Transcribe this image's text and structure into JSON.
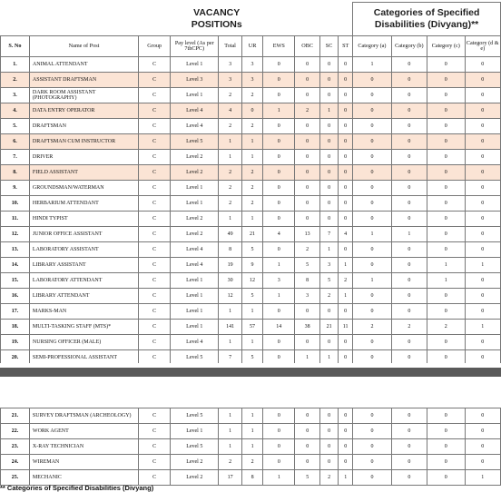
{
  "header": {
    "vacancy_title": "VACANCY POSITIONs",
    "categories_title": "Categories of Specified Disabilities (Divyang)**",
    "columns": [
      "S. No",
      "Name of Post",
      "Group",
      "Pay level (As per 7thCPC)",
      "Total",
      "UR",
      "EWS",
      "OBC",
      "SC",
      "ST",
      "Category (a)",
      "Category (b)",
      "Category (c)",
      "Category (d & e)"
    ]
  },
  "rows": [
    {
      "sno": "1.",
      "post": "ANIMAL ATTENDANT",
      "group": "C",
      "pay": "Level 1",
      "total": "3",
      "ur": "3",
      "ews": "0",
      "obc": "0",
      "sc": "0",
      "st": "0",
      "a": "1",
      "b": "0",
      "c": "0",
      "de": "0",
      "highlight": false
    },
    {
      "sno": "2.",
      "post": "ASSISTANT DRAFTSMAN",
      "group": "C",
      "pay": "Level 3",
      "total": "3",
      "ur": "3",
      "ews": "0",
      "obc": "0",
      "sc": "0",
      "st": "0",
      "a": "0",
      "b": "0",
      "c": "0",
      "de": "0",
      "highlight": true
    },
    {
      "sno": "3.",
      "post": "DARK ROOM ASSISTANT (PHOTOGRAPHY)",
      "group": "C",
      "pay": "Level 1",
      "total": "2",
      "ur": "2",
      "ews": "0",
      "obc": "0",
      "sc": "0",
      "st": "0",
      "a": "0",
      "b": "0",
      "c": "0",
      "de": "0",
      "highlight": false
    },
    {
      "sno": "4.",
      "post": "DATA ENTRY OPERATOR",
      "group": "C",
      "pay": "Level 4",
      "total": "4",
      "ur": "0",
      "ews": "1",
      "obc": "2",
      "sc": "1",
      "st": "0",
      "a": "0",
      "b": "0",
      "c": "0",
      "de": "0",
      "highlight": true
    },
    {
      "sno": "5.",
      "post": "DRAFTSMAN",
      "group": "C",
      "pay": "Level 4",
      "total": "2",
      "ur": "2",
      "ews": "0",
      "obc": "0",
      "sc": "0",
      "st": "0",
      "a": "0",
      "b": "0",
      "c": "0",
      "de": "0",
      "highlight": false
    },
    {
      "sno": "6.",
      "post": "DRAFTSMAN CUM INSTRUCTOR",
      "group": "C",
      "pay": "Level 5",
      "total": "1",
      "ur": "1",
      "ews": "0",
      "obc": "0",
      "sc": "0",
      "st": "0",
      "a": "0",
      "b": "0",
      "c": "0",
      "de": "0",
      "highlight": true
    },
    {
      "sno": "7.",
      "post": "DRIVER",
      "group": "C",
      "pay": "Level 2",
      "total": "1",
      "ur": "1",
      "ews": "0",
      "obc": "0",
      "sc": "0",
      "st": "0",
      "a": "0",
      "b": "0",
      "c": "0",
      "de": "0",
      "highlight": false
    },
    {
      "sno": "8.",
      "post": "FIELD ASSISTANT",
      "group": "C",
      "pay": "Level 2",
      "total": "2",
      "ur": "2",
      "ews": "0",
      "obc": "0",
      "sc": "0",
      "st": "0",
      "a": "0",
      "b": "0",
      "c": "0",
      "de": "0",
      "highlight": true
    },
    {
      "sno": "9.",
      "post": "GROUNDSMAN/WATERMAN",
      "group": "C",
      "pay": "Level 1",
      "total": "2",
      "ur": "2",
      "ews": "0",
      "obc": "0",
      "sc": "0",
      "st": "0",
      "a": "0",
      "b": "0",
      "c": "0",
      "de": "0",
      "highlight": false
    },
    {
      "sno": "10.",
      "post": "HERBARIUM ATTENDANT",
      "group": "C",
      "pay": "Level 1",
      "total": "2",
      "ur": "2",
      "ews": "0",
      "obc": "0",
      "sc": "0",
      "st": "0",
      "a": "0",
      "b": "0",
      "c": "0",
      "de": "0",
      "highlight": false
    },
    {
      "sno": "11.",
      "post": "HINDI TYPIST",
      "group": "C",
      "pay": "Level 2",
      "total": "1",
      "ur": "1",
      "ews": "0",
      "obc": "0",
      "sc": "0",
      "st": "0",
      "a": "0",
      "b": "0",
      "c": "0",
      "de": "0",
      "highlight": false
    },
    {
      "sno": "12.",
      "post": "JUNIOR OFFICE ASSISTANT",
      "group": "C",
      "pay": "Level 2",
      "total": "49",
      "ur": "21",
      "ews": "4",
      "obc": "13",
      "sc": "7",
      "st": "4",
      "a": "1",
      "b": "1",
      "c": "0",
      "de": "0",
      "highlight": false
    },
    {
      "sno": "13.",
      "post": "LABORATORY ASSISTANT",
      "group": "C",
      "pay": "Level 4",
      "total": "8",
      "ur": "5",
      "ews": "0",
      "obc": "2",
      "sc": "1",
      "st": "0",
      "a": "0",
      "b": "0",
      "c": "0",
      "de": "0",
      "highlight": false
    },
    {
      "sno": "14.",
      "post": "LIBRARY ASSISTANT",
      "group": "C",
      "pay": "Level 4",
      "total": "19",
      "ur": "9",
      "ews": "1",
      "obc": "5",
      "sc": "3",
      "st": "1",
      "a": "0",
      "b": "0",
      "c": "1",
      "de": "1",
      "highlight": false
    },
    {
      "sno": "15.",
      "post": "LABORATORY ATTENDANT",
      "group": "C",
      "pay": "Level 1",
      "total": "30",
      "ur": "12",
      "ews": "3",
      "obc": "8",
      "sc": "5",
      "st": "2",
      "a": "1",
      "b": "0",
      "c": "1",
      "de": "0",
      "highlight": false
    },
    {
      "sno": "16.",
      "post": "LIBRARY ATTENDANT",
      "group": "C",
      "pay": "Level 1",
      "total": "12",
      "ur": "5",
      "ews": "1",
      "obc": "3",
      "sc": "2",
      "st": "1",
      "a": "0",
      "b": "0",
      "c": "0",
      "de": "0",
      "highlight": false
    },
    {
      "sno": "17.",
      "post": "MARKS-MAN",
      "group": "C",
      "pay": "Level 1",
      "total": "1",
      "ur": "1",
      "ews": "0",
      "obc": "0",
      "sc": "0",
      "st": "0",
      "a": "0",
      "b": "0",
      "c": "0",
      "de": "0",
      "highlight": false
    },
    {
      "sno": "18.",
      "post": "MULTI-TASKING STAFF (MTS)*",
      "group": "C",
      "pay": "Level 1",
      "total": "141",
      "ur": "57",
      "ews": "14",
      "obc": "38",
      "sc": "21",
      "st": "11",
      "a": "2",
      "b": "2",
      "c": "2",
      "de": "1",
      "highlight": false
    },
    {
      "sno": "19.",
      "post": "NURSING OFFICER (MALE)",
      "group": "C",
      "pay": "Level 4",
      "total": "1",
      "ur": "1",
      "ews": "0",
      "obc": "0",
      "sc": "0",
      "st": "0",
      "a": "0",
      "b": "0",
      "c": "0",
      "de": "0",
      "highlight": false
    },
    {
      "sno": "20.",
      "post": "SEMI-PROFESSIONAL ASSISTANT",
      "group": "C",
      "pay": "Level 5",
      "total": "7",
      "ur": "5",
      "ews": "0",
      "obc": "1",
      "sc": "1",
      "st": "0",
      "a": "0",
      "b": "0",
      "c": "0",
      "de": "0",
      "highlight": false
    }
  ],
  "rows2": [
    {
      "sno": "21.",
      "post": "SURVEY DRAFTSMAN (ARCHEOLOGY)",
      "group": "C",
      "pay": "Level 5",
      "total": "1",
      "ur": "1",
      "ews": "0",
      "obc": "0",
      "sc": "0",
      "st": "0",
      "a": "0",
      "b": "0",
      "c": "0",
      "de": "0",
      "highlight": false
    },
    {
      "sno": "22.",
      "post": "WORK AGENT",
      "group": "C",
      "pay": "Level 1",
      "total": "1",
      "ur": "1",
      "ews": "0",
      "obc": "0",
      "sc": "0",
      "st": "0",
      "a": "0",
      "b": "0",
      "c": "0",
      "de": "0",
      "highlight": false
    },
    {
      "sno": "23.",
      "post": "X-RAY TECHNICIAN",
      "group": "C",
      "pay": "Level 5",
      "total": "1",
      "ur": "1",
      "ews": "0",
      "obc": "0",
      "sc": "0",
      "st": "0",
      "a": "0",
      "b": "0",
      "c": "0",
      "de": "0",
      "highlight": false
    },
    {
      "sno": "24.",
      "post": "WIREMAN",
      "group": "C",
      "pay": "Level 2",
      "total": "2",
      "ur": "2",
      "ews": "0",
      "obc": "0",
      "sc": "0",
      "st": "0",
      "a": "0",
      "b": "0",
      "c": "0",
      "de": "0",
      "highlight": false
    },
    {
      "sno": "25.",
      "post": "MECHANIC",
      "group": "C",
      "pay": "Level 2",
      "total": "17",
      "ur": "8",
      "ews": "1",
      "obc": "5",
      "sc": "2",
      "st": "1",
      "a": "0",
      "b": "0",
      "c": "0",
      "de": "1",
      "highlight": false
    }
  ],
  "footnote": "** Categories of Specified Disabilities (Divyang)",
  "colors": {
    "highlight_row": "#fbe4d5",
    "separator_bar": "#5a5a5a",
    "border": "#777777"
  }
}
